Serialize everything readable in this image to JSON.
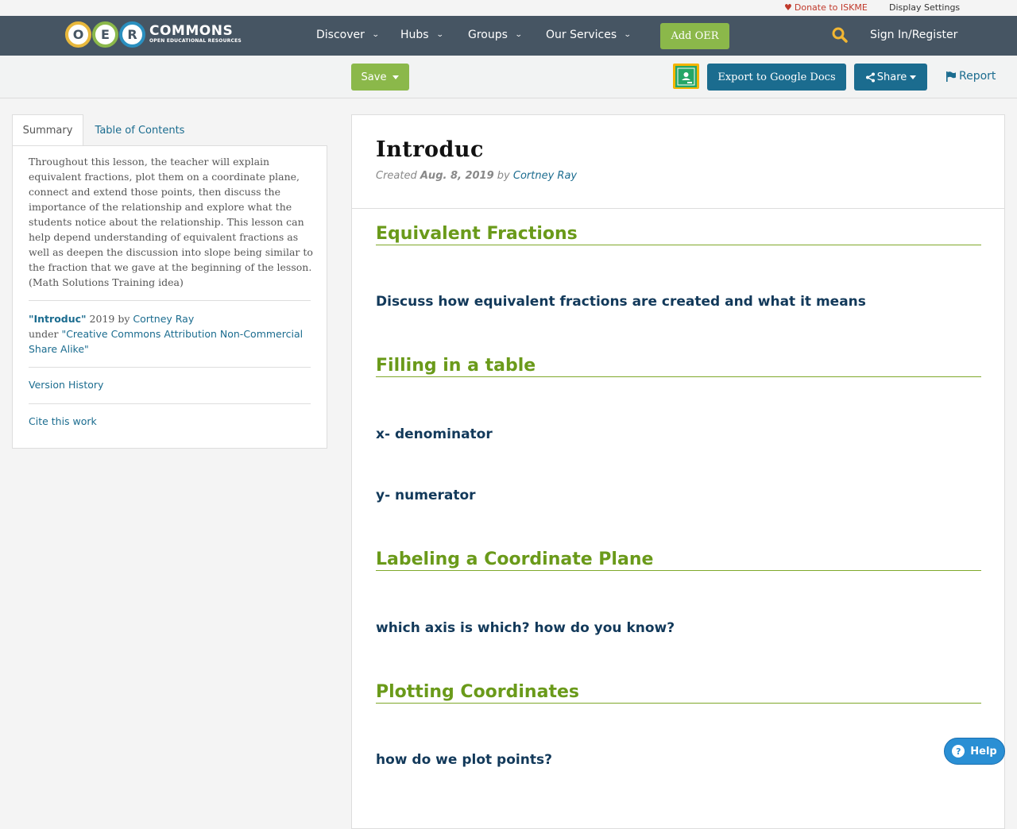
{
  "utility": {
    "donate_label": "Donate to ISKME",
    "display_settings_label": "Display Settings"
  },
  "nav": {
    "logo_letters": [
      "O",
      "E",
      "R"
    ],
    "logo_word": "COMMONS",
    "logo_tagline": "OPEN EDUCATIONAL RESOURCES",
    "items": [
      {
        "label": "Discover"
      },
      {
        "label": "Hubs"
      },
      {
        "label": "Groups"
      },
      {
        "label": "Our Services"
      }
    ],
    "add_oer_label": "Add OER",
    "signin_label": "Sign In/Register"
  },
  "actions": {
    "save_label": "Save",
    "export_label": "Export to Google Docs",
    "share_label": "Share",
    "report_label": "Report"
  },
  "sidebar": {
    "tabs": [
      {
        "label": "Summary",
        "active": true
      },
      {
        "label": "Table of Contents",
        "active": false
      }
    ],
    "summary": "Throughout this lesson, the teacher will explain equivalent fractions, plot them on a coordinate plane, connect and extend those points, then discuss the importance of the relationship and explore what the students notice about the relationship. This lesson can help depend understanding of equivalent fractions as well as deepen the discussion into slope being similar to the fraction that we gave at the beginning of the lesson. (Math Solutions Training idea)",
    "attribution": {
      "title": "\"Introduc\"",
      "year_by": " 2019 by ",
      "author": "Cortney Ray",
      "under": "under ",
      "license": "\"Creative Commons Attribution Non-Commercial Share Alike\""
    },
    "version_history_label": "Version History",
    "cite_label": "Cite this work"
  },
  "document": {
    "title": "Introduc",
    "created_prefix": "Created ",
    "created_date": "Aug. 8, 2019",
    "created_by": " by ",
    "author": "Cortney Ray",
    "sections": [
      {
        "heading": "Equivalent Fractions",
        "lines": [
          "Discuss how equivalent fractions are created and what it means"
        ]
      },
      {
        "heading": "Filling in a table",
        "lines": [
          "x- denominator",
          "y- numerator"
        ]
      },
      {
        "heading": "Labeling a Coordinate Plane",
        "lines": [
          "which axis is which? how do you know?"
        ]
      },
      {
        "heading": "Plotting Coordinates",
        "lines": [
          "how do we plot points?"
        ]
      }
    ]
  },
  "help": {
    "label": "Help"
  },
  "colors": {
    "navbar": "#465563",
    "green": "#8bb84a",
    "teal": "#1b6c8f",
    "section_heading": "#6a9a1a",
    "section_text": "#12395a"
  }
}
